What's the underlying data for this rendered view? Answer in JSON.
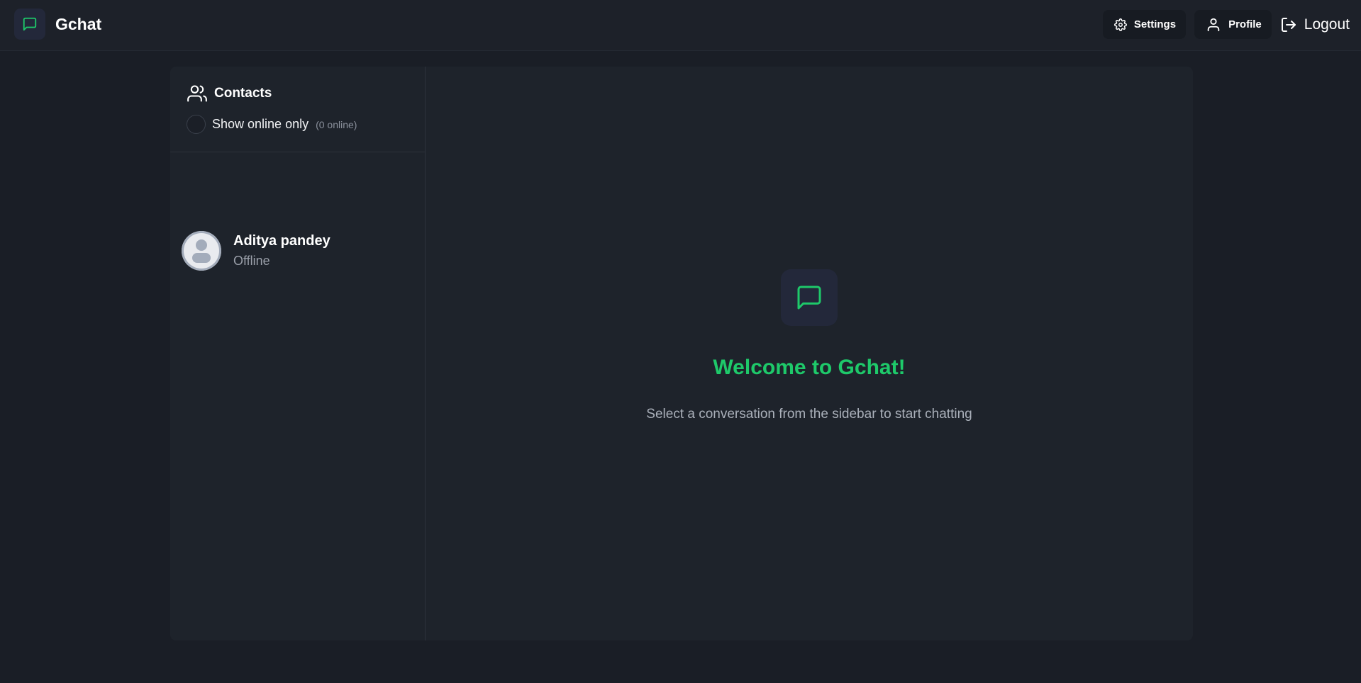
{
  "app": {
    "name": "Gchat"
  },
  "navbar": {
    "settings_label": "Settings",
    "profile_label": "Profile",
    "logout_label": "Logout"
  },
  "sidebar": {
    "title": "Contacts",
    "filter_label": "Show online only",
    "online_count": "(0 online)",
    "filter_checked": false,
    "contacts": [
      {
        "name": "Aditya pandey",
        "status": "Offline"
      }
    ]
  },
  "welcome": {
    "title": "Welcome to Gchat!",
    "subtitle": "Select a conversation from the sidebar to start chatting"
  },
  "icons": {
    "brand": "message-square-icon",
    "settings": "gear-icon",
    "profile": "user-icon",
    "logout": "log-out-icon",
    "contacts": "users-icon",
    "avatar": "default-avatar-icon",
    "welcome": "message-square-icon"
  },
  "colors": {
    "accent": "#1ec96a",
    "background": "#1a1e26",
    "panel": "#1e232b",
    "icon_tile": "#23283a"
  }
}
